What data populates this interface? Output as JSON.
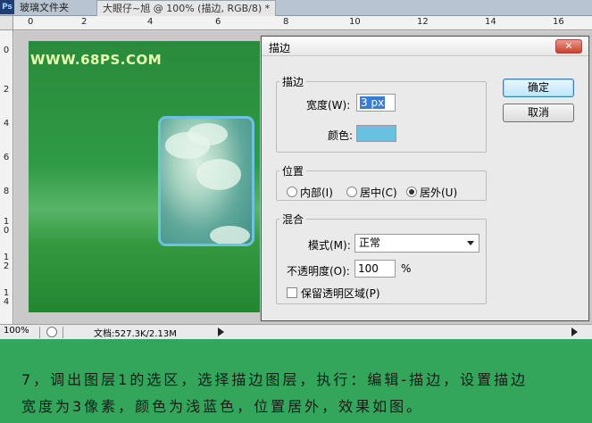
{
  "app": {
    "icon_label": "Ps",
    "tabs": [
      "玻璃文件夹",
      "大眼仔~旭 @ 100% (描边, RGB/8) *"
    ]
  },
  "ruler": {
    "top_labels": [
      "0",
      "2",
      "4",
      "6",
      "8",
      "10",
      "12",
      "14",
      "16"
    ],
    "left_labels": [
      "0",
      "2",
      "4",
      "6",
      "8",
      "1\n0",
      "1\n2",
      "1\n4"
    ]
  },
  "canvas": {
    "watermark": "WWW.68PS.COM"
  },
  "statusbar": {
    "zoom": "100%",
    "doc_info": "文档:527.3K/2.13M"
  },
  "dialog": {
    "title": "描边",
    "close_label": "✕",
    "stroke_group": {
      "legend": "描边",
      "width_label": "宽度(W):",
      "width_value": "3 px",
      "color_label": "颜色:",
      "color": "#6ac0df"
    },
    "position_group": {
      "legend": "位置",
      "options": [
        "内部(I)",
        "居中(C)",
        "居外(U)"
      ],
      "selected": "居外(U)"
    },
    "blend_group": {
      "legend": "混合",
      "mode_label": "模式(M):",
      "mode_value": "正常",
      "opacity_label": "不透明度(O):",
      "opacity_value": "100",
      "opacity_unit": "%",
      "preserve_label": "保留透明区域(P)",
      "preserve_checked": false
    },
    "ok_label": "确定",
    "cancel_label": "取消"
  },
  "caption": {
    "line1": "7，调出图层1的选区，选择描边图层，执行：编辑-描边，设置描边",
    "line2": "宽度为3像素，颜色为浅蓝色，位置居外，效果如图。"
  },
  "colors": {
    "caption_bg": "#33a65b",
    "canvas_green": "#2f9a45",
    "stroke_blue": "#6ac0df"
  }
}
